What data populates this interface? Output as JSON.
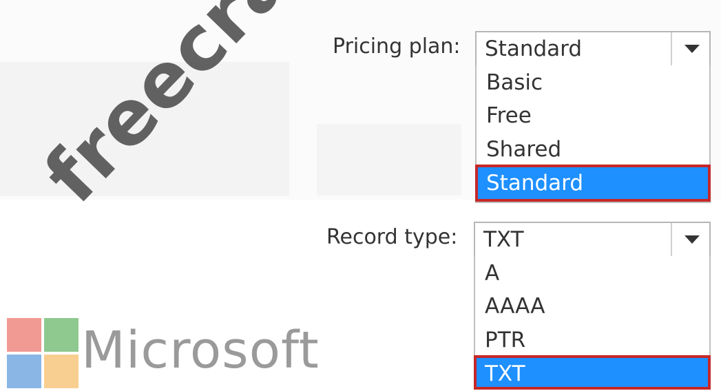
{
  "pricing": {
    "label": "Pricing plan:",
    "value": "Standard",
    "options": [
      "Basic",
      "Free",
      "Shared",
      "Standard"
    ],
    "selected": "Standard"
  },
  "record": {
    "label": "Record type:",
    "value": "TXT",
    "options": [
      "A",
      "AAAA",
      "PTR",
      "TXT"
    ],
    "selected": "TXT"
  },
  "watermark": "freecram.net",
  "logo": {
    "text": "Microsoft"
  },
  "colors": {
    "selected_bg": "#1e90ff",
    "highlight_border": "#c62828"
  }
}
